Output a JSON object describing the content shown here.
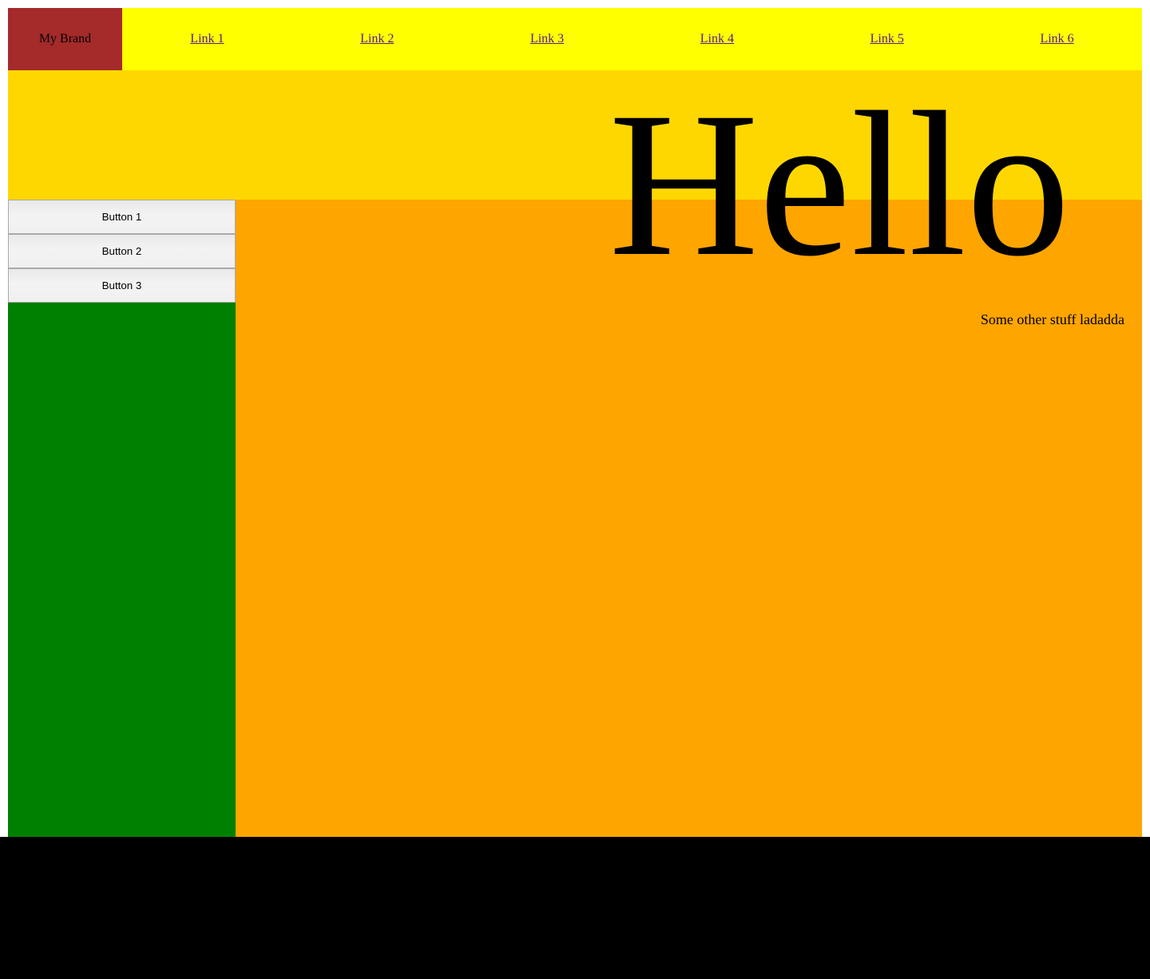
{
  "colors": {
    "navbar_bg": "#FFFF00",
    "brand_bg": "#A52A2A",
    "hero_bg": "#FFD700",
    "sidebar_bg": "#008000",
    "content_bg": "#FFA500",
    "footer_bg": "#000000",
    "link": "#551A8B",
    "text": "#000000"
  },
  "navbar": {
    "brand_label": "My Brand",
    "links": [
      {
        "label": "Link 1"
      },
      {
        "label": "Link 2"
      },
      {
        "label": "Link 3"
      },
      {
        "label": "Link 4"
      },
      {
        "label": "Link 5"
      },
      {
        "label": "Link 6"
      }
    ]
  },
  "hero": {
    "title": "Hello"
  },
  "sidebar": {
    "buttons": [
      {
        "label": "Button 1"
      },
      {
        "label": "Button 2"
      },
      {
        "label": "Button 3"
      }
    ]
  },
  "content": {
    "note": "Some other stuff ladadda"
  },
  "footer": {
    "text": ""
  }
}
